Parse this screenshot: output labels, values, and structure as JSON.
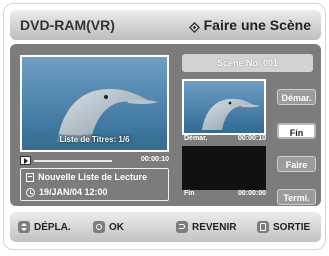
{
  "header": {
    "app_title": "DVD-RAM(VR)",
    "mode_title": "Faire une Scène"
  },
  "player": {
    "playlist_caption": "Liste de Titres: 1/6",
    "time": "00:00:10",
    "info_title": "Nouvelle Liste de Lecture",
    "info_date": "19/JAN/04 12:00"
  },
  "scene": {
    "header": "Scène No. 001",
    "start_label": "Démar.",
    "start_time": "00:00:10",
    "end_label": "Fin",
    "end_time": "00:00:00"
  },
  "buttons": {
    "start": "Démar.",
    "end": "Fin",
    "make": "Faire",
    "finish": "Termi."
  },
  "bottom_bar": {
    "move": "DÉPLA.",
    "ok": "OK",
    "return": "REVENIR",
    "exit": "SORTIE"
  },
  "colors": {
    "panel": "#7c7c7c",
    "header_gradient_top": "#ececec",
    "header_gradient_bottom": "#bdbdbd",
    "button": "#9b9b9b",
    "selected_button": "#ffffff"
  }
}
